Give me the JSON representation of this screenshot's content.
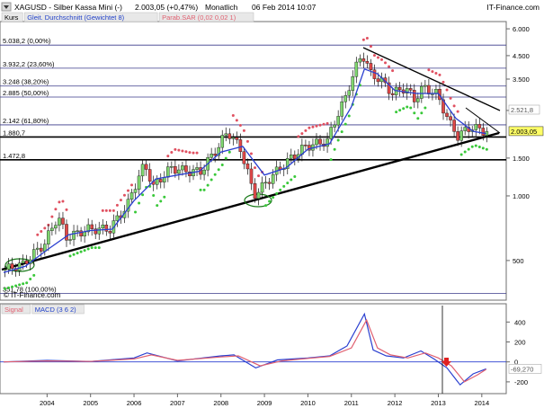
{
  "header": {
    "symbol": "XAGUSD - Silber Kassa Mini (-)",
    "quote": "2.003,05 (+0,47%)",
    "period": "Monatlich",
    "datetime": "06 Feb 2014 10:07",
    "brand": "IT-Finance.com"
  },
  "legend_main": [
    {
      "text": "Kurs",
      "color": "#000000",
      "bg": "#e8e8e8"
    },
    {
      "text": "Gleit. Durchschnitt (Gewichtet 8)",
      "color": "#1f3fc8",
      "bg": "#e8e8e8"
    },
    {
      "text": "Parab.SAR (0,02 0,02 1)",
      "color": "#e06070",
      "bg": "#e8e8e8"
    }
  ],
  "legend_macd": [
    {
      "text": "Signal",
      "color": "#e06070",
      "bg": "#e8e8e8"
    },
    {
      "text": "MACD (3 6 2)",
      "color": "#1f3fc8",
      "bg": "#e8e8e8"
    }
  ],
  "copyright": "© IT-Finance.com",
  "fib_levels": [
    {
      "label": "5.038,2 (0,00%)",
      "value": 5038.2
    },
    {
      "label": "3.932,2 (23,60%)",
      "value": 3932.2
    },
    {
      "label": "3.248 (38,20%)",
      "value": 3248
    },
    {
      "label": "2.885 (50,00%)",
      "value": 2885
    },
    {
      "label": "2.142 (61,80%)",
      "value": 2142
    },
    {
      "label": "1.880,7",
      "value": 1880.7
    },
    {
      "label": "1.472,8",
      "value": 1472.8
    },
    {
      "label": "351,78 (100,00%)",
      "value": 351.78
    }
  ],
  "price_axis_ticks": [
    {
      "label": "6.000",
      "value": 6000
    },
    {
      "label": "4.500",
      "value": 4500
    },
    {
      "label": "3.500",
      "value": 3500
    },
    {
      "label": "2.500",
      "value": 2500
    },
    {
      "label": "1.500",
      "value": 1500
    },
    {
      "label": "1.000",
      "value": 1000
    },
    {
      "label": "500",
      "value": 500
    }
  ],
  "last_price_label": "2.003,05",
  "mid_price_label": "2.521,8",
  "macd_axis_ticks": [
    {
      "label": "400",
      "value": 400
    },
    {
      "label": "200",
      "value": 200
    },
    {
      "label": "0",
      "value": 0
    },
    {
      "label": "-200",
      "value": -200
    }
  ],
  "macd_last_label": "-69,270",
  "x_axis_ticks": [
    "2004",
    "2005",
    "2006",
    "2007",
    "2008",
    "2009",
    "2010",
    "2011",
    "2012",
    "2013",
    "2014"
  ],
  "chart_data": {
    "type": "line",
    "scale": "log",
    "ylim": [
      330,
      6300
    ],
    "x_range": [
      2003.0,
      2014.5
    ],
    "series": [
      {
        "name": "Kurs",
        "x": [
          2003.0,
          2003.5,
          2004.0,
          2004.3,
          2004.5,
          2005.0,
          2005.5,
          2005.9,
          2006.3,
          2006.5,
          2006.9,
          2007.3,
          2007.6,
          2008.0,
          2008.2,
          2008.5,
          2008.8,
          2009.0,
          2009.5,
          2010.0,
          2010.5,
          2010.9,
          2011.3,
          2011.5,
          2011.7,
          2012.0,
          2012.3,
          2012.5,
          2012.7,
          2013.0,
          2013.3,
          2013.5,
          2013.8,
          2014.1
        ],
        "y": [
          450,
          480,
          600,
          800,
          640,
          700,
          700,
          900,
          1400,
          1100,
          1350,
          1300,
          1300,
          1700,
          2000,
          1650,
          1000,
          1100,
          1400,
          1700,
          1800,
          2800,
          4600,
          3700,
          3500,
          3000,
          3200,
          2800,
          3200,
          3000,
          2200,
          1900,
          2100,
          2003
        ]
      },
      {
        "name": "Gleit. Durchschnitt (Gewichtet 8)",
        "x": [
          2003.0,
          2003.5,
          2004.0,
          2004.5,
          2005.0,
          2005.5,
          2006.0,
          2006.5,
          2007.0,
          2007.5,
          2008.0,
          2008.5,
          2009.0,
          2009.5,
          2010.0,
          2010.5,
          2011.0,
          2011.3,
          2011.6,
          2012.0,
          2012.5,
          2013.0,
          2013.4,
          2013.8,
          2014.1
        ],
        "y": [
          440,
          470,
          560,
          660,
          690,
          700,
          950,
          1200,
          1250,
          1300,
          1600,
          1700,
          1250,
          1350,
          1650,
          1750,
          2600,
          3900,
          3700,
          3100,
          3000,
          3000,
          2300,
          2000,
          1950
        ]
      }
    ],
    "fibonacci": [
      5038.2,
      3932.2,
      3248,
      2885,
      2142,
      1880.7,
      1472.8,
      351.78
    ]
  },
  "macd_data": {
    "type": "line",
    "ylim": [
      -300,
      520
    ],
    "series": [
      {
        "name": "MACD (3 6 2)",
        "x": [
          2003.0,
          2004.0,
          2005.0,
          2006.0,
          2006.3,
          2007.0,
          2008.0,
          2008.3,
          2008.8,
          2009.3,
          2010.0,
          2010.5,
          2010.9,
          2011.3,
          2011.5,
          2011.8,
          2012.2,
          2012.6,
          2012.9,
          2013.2,
          2013.5,
          2013.8,
          2014.1
        ],
        "y": [
          0,
          15,
          5,
          40,
          90,
          10,
          60,
          70,
          -60,
          20,
          40,
          60,
          160,
          480,
          120,
          60,
          40,
          110,
          30,
          -60,
          -230,
          -120,
          -69
        ]
      },
      {
        "name": "Signal",
        "x": [
          2003.0,
          2004.0,
          2005.0,
          2006.0,
          2006.4,
          2007.0,
          2008.0,
          2008.4,
          2008.9,
          2009.4,
          2010.0,
          2010.5,
          2011.0,
          2011.35,
          2011.6,
          2011.9,
          2012.3,
          2012.7,
          2013.0,
          2013.3,
          2013.6,
          2013.9,
          2014.1
        ],
        "y": [
          0,
          10,
          5,
          30,
          70,
          15,
          50,
          60,
          -40,
          10,
          35,
          55,
          140,
          420,
          140,
          70,
          40,
          90,
          40,
          -40,
          -200,
          -130,
          -75
        ]
      }
    ]
  }
}
